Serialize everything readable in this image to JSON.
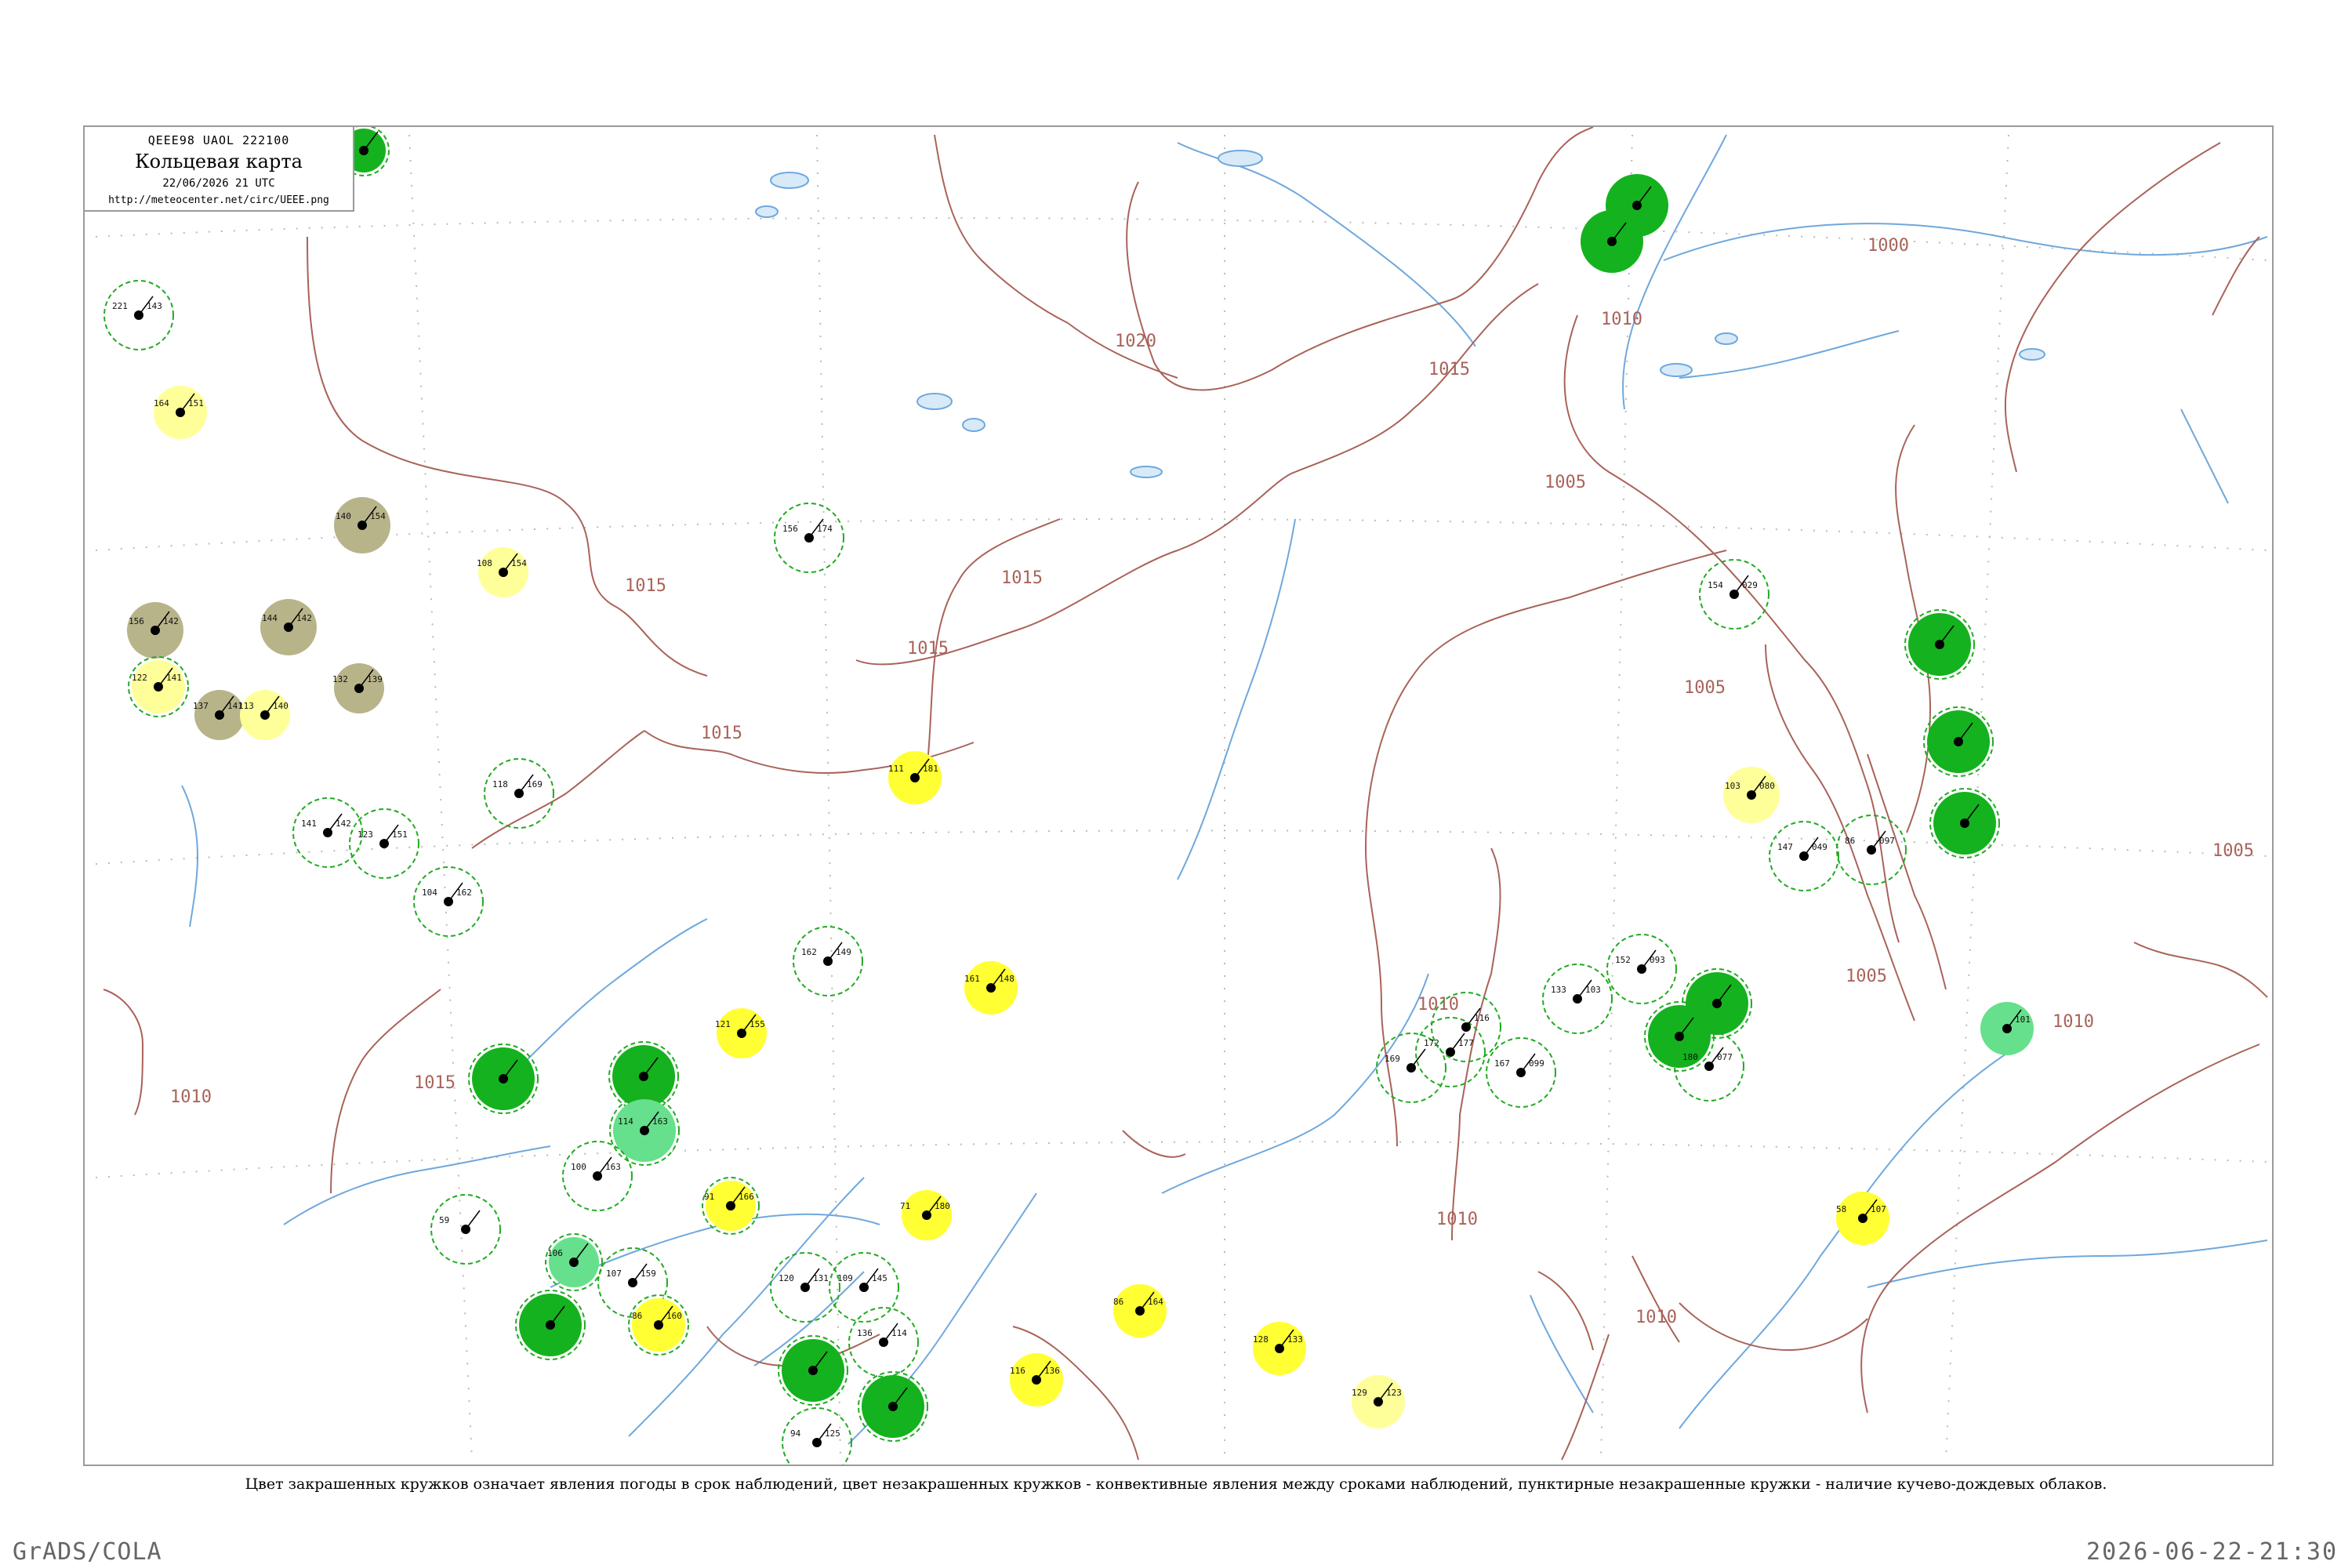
{
  "header": {
    "code": "QEEE98 UAOL 222100",
    "title": "Кольцевая карта",
    "date": "22/06/2026 21 UTC",
    "url": "http://meteocenter.net/circ/UEEE.png"
  },
  "caption": "Цвет закрашенных кружков означает явления погоды в срок наблюдений, цвет незакрашенных кружков - конвективные явления между сроками наблюдений, пунктирные незакрашенные кружки - наличие кучево-дождевых облаков.",
  "footer": {
    "left": "GrADS/COLA",
    "right": "2026-06-22-21:30"
  },
  "colors": {
    "isobar": "#a9635a",
    "water": "#6fa8dc",
    "green_dark": "#14b21e",
    "green_light": "#66e08c",
    "yellow": "#ffff33",
    "yellow_pale": "#ffff99",
    "olive": "#b8b48a",
    "dashed_ring": "#22aa22"
  },
  "isobars": [
    {
      "label": "1020"
    },
    {
      "label": "1015"
    },
    {
      "label": "1015"
    },
    {
      "label": "1015"
    },
    {
      "label": "1015"
    },
    {
      "label": "1015"
    },
    {
      "label": "1015"
    },
    {
      "label": "1010"
    },
    {
      "label": "1010"
    },
    {
      "label": "1010"
    },
    {
      "label": "1010"
    },
    {
      "label": "1010"
    },
    {
      "label": "1010"
    },
    {
      "label": "1005"
    },
    {
      "label": "1005"
    },
    {
      "label": "1005"
    },
    {
      "label": "1005"
    },
    {
      "label": "1000"
    }
  ],
  "stations": [
    {
      "fill": "green_dark",
      "ring": true,
      "t": "",
      "p": ""
    },
    {
      "fill": "",
      "ring": true,
      "t": "221",
      "p": "143"
    },
    {
      "fill": "yellow_pale",
      "ring": false,
      "t": "164",
      "p": "151"
    },
    {
      "fill": "olive",
      "ring": false,
      "t": "140",
      "p": "154"
    },
    {
      "fill": "yellow_pale",
      "ring": false,
      "t": "108",
      "p": "154"
    },
    {
      "fill": "olive",
      "ring": false,
      "t": "156",
      "p": "142"
    },
    {
      "fill": "olive",
      "ring": false,
      "t": "144",
      "p": "142"
    },
    {
      "fill": "yellow_pale",
      "ring": true,
      "t": "122",
      "p": "141"
    },
    {
      "fill": "olive",
      "ring": false,
      "t": "137",
      "p": "141"
    },
    {
      "fill": "olive",
      "ring": false,
      "t": "132",
      "p": "139"
    },
    {
      "fill": "yellow_pale",
      "ring": false,
      "t": "113",
      "p": "140"
    },
    {
      "fill": "",
      "ring": true,
      "t": "156",
      "p": "174"
    },
    {
      "fill": "yellow",
      "ring": false,
      "t": "111",
      "p": "181"
    },
    {
      "fill": "",
      "ring": true,
      "t": "118",
      "p": "169"
    },
    {
      "fill": "",
      "ring": true,
      "t": "141",
      "p": "142"
    },
    {
      "fill": "",
      "ring": true,
      "t": "123",
      "p": "151"
    },
    {
      "fill": "",
      "ring": true,
      "t": "104",
      "p": "162"
    },
    {
      "fill": "",
      "ring": true,
      "t": "162",
      "p": "149"
    },
    {
      "fill": "yellow",
      "ring": false,
      "t": "161",
      "p": "148"
    },
    {
      "fill": "yellow",
      "ring": false,
      "t": "121",
      "p": "155"
    },
    {
      "fill": "green_dark",
      "ring": true,
      "t": "",
      "p": ""
    },
    {
      "fill": "green_dark",
      "ring": true,
      "t": "",
      "p": ""
    },
    {
      "fill": "green_light",
      "ring": true,
      "t": "114",
      "p": "163"
    },
    {
      "fill": "",
      "ring": true,
      "t": "100",
      "p": "163"
    },
    {
      "fill": "yellow",
      "ring": true,
      "t": "91",
      "p": "166"
    },
    {
      "fill": "yellow",
      "ring": false,
      "t": "71",
      "p": "180"
    },
    {
      "fill": "",
      "ring": true,
      "t": "59",
      "p": ""
    },
    {
      "fill": "green_light",
      "ring": true,
      "t": "106",
      "p": ""
    },
    {
      "fill": "green_dark",
      "ring": true,
      "t": "",
      "p": ""
    },
    {
      "fill": "",
      "ring": true,
      "t": "107",
      "p": "159"
    },
    {
      "fill": "yellow",
      "ring": true,
      "t": "86",
      "p": "160"
    },
    {
      "fill": "",
      "ring": true,
      "t": "120",
      "p": "131"
    },
    {
      "fill": "",
      "ring": true,
      "t": "109",
      "p": "145"
    },
    {
      "fill": "",
      "ring": true,
      "t": "136",
      "p": "114"
    },
    {
      "fill": "green_dark",
      "ring": true,
      "t": "",
      "p": ""
    },
    {
      "fill": "green_dark",
      "ring": true,
      "t": "",
      "p": ""
    },
    {
      "fill": "",
      "ring": true,
      "t": "94",
      "p": "125"
    },
    {
      "fill": "yellow",
      "ring": false,
      "t": "116",
      "p": "136"
    },
    {
      "fill": "yellow",
      "ring": false,
      "t": "86",
      "p": "164"
    },
    {
      "fill": "yellow",
      "ring": false,
      "t": "128",
      "p": "133"
    },
    {
      "fill": "yellow_pale",
      "ring": false,
      "t": "129",
      "p": "123"
    },
    {
      "fill": "",
      "ring": true,
      "t": "169",
      "p": ""
    },
    {
      "fill": "",
      "ring": true,
      "t": "172",
      "p": "177"
    },
    {
      "fill": "",
      "ring": true,
      "t": "",
      "p": "116"
    },
    {
      "fill": "",
      "ring": true,
      "t": "167",
      "p": "099"
    },
    {
      "fill": "",
      "ring": true,
      "t": "133",
      "p": "103"
    },
    {
      "fill": "",
      "ring": true,
      "t": "152",
      "p": "093"
    },
    {
      "fill": "green_dark",
      "ring": true,
      "t": "",
      "p": ""
    },
    {
      "fill": "green_dark",
      "ring": true,
      "t": "",
      "p": ""
    },
    {
      "fill": "",
      "ring": true,
      "t": "180",
      "p": "077"
    },
    {
      "fill": "green_dark",
      "ring": false,
      "t": "",
      "p": ""
    },
    {
      "fill": "green_dark",
      "ring": false,
      "t": "",
      "p": ""
    },
    {
      "fill": "",
      "ring": true,
      "t": "154",
      "p": "029"
    },
    {
      "fill": "green_dark",
      "ring": true,
      "t": "",
      "p": ""
    },
    {
      "fill": "green_dark",
      "ring": true,
      "t": "",
      "p": ""
    },
    {
      "fill": "green_dark",
      "ring": true,
      "t": "",
      "p": ""
    },
    {
      "fill": "yellow_pale",
      "ring": false,
      "t": "103",
      "p": "080"
    },
    {
      "fill": "",
      "ring": true,
      "t": "147",
      "p": "049"
    },
    {
      "fill": "",
      "ring": true,
      "t": "86",
      "p": "097"
    },
    {
      "fill": "green_light",
      "ring": false,
      "t": "",
      "p": "101"
    },
    {
      "fill": "yellow",
      "ring": false,
      "t": "58",
      "p": "107"
    }
  ]
}
